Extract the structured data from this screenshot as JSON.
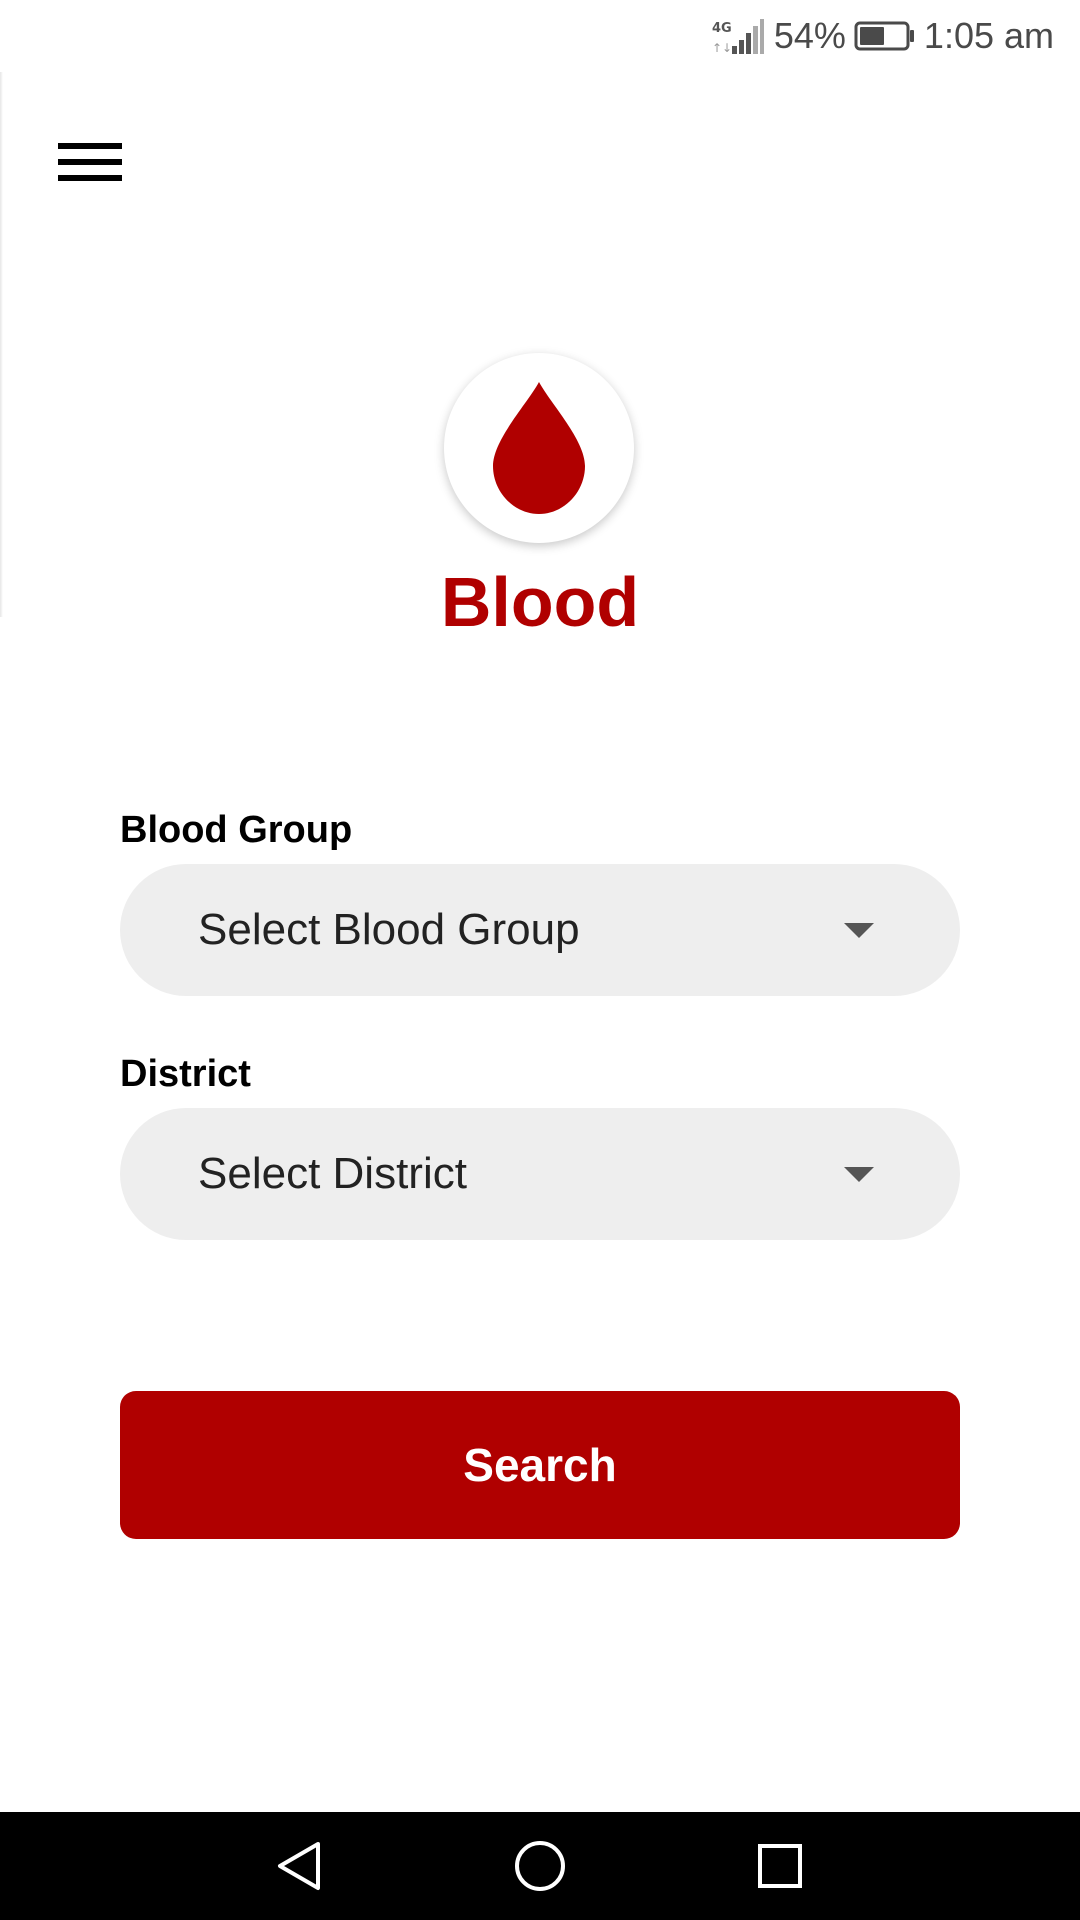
{
  "status_bar": {
    "network": "4G",
    "battery_percent": "54%",
    "time": "1:05 am",
    "battery_level": 0.54,
    "icons": [
      "signal-4g-icon",
      "battery-icon"
    ]
  },
  "header": {
    "menu_icon": "hamburger-menu-icon"
  },
  "logo": {
    "icon": "blood-drop-icon",
    "title": "Blood",
    "color": "#b00000"
  },
  "form": {
    "blood_group": {
      "label": "Blood Group",
      "value": "Select Blood Group"
    },
    "district": {
      "label": "District",
      "value": "Select District"
    },
    "search_label": "Search"
  },
  "colors": {
    "accent": "#b00000",
    "pill_background": "#eeeeee",
    "nav_background": "#000000"
  },
  "nav_bar": {
    "icons": [
      "back-icon",
      "home-icon",
      "recent-apps-icon"
    ]
  }
}
